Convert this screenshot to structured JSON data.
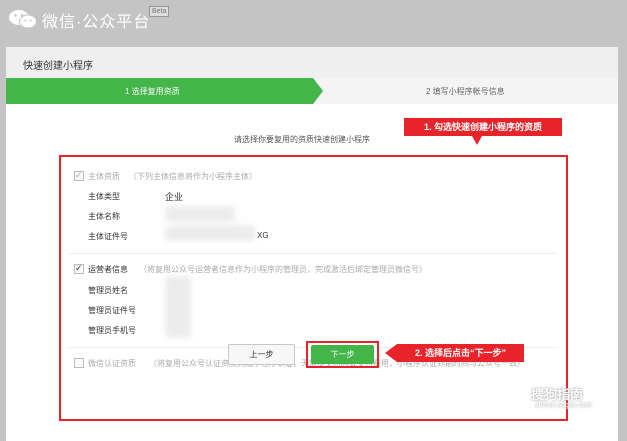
{
  "header": {
    "brand": "微信·公众平台",
    "beta": "Beta"
  },
  "modal": {
    "title": "快速创建小程序",
    "steps": [
      {
        "label": "1 选择复用资质",
        "active": true
      },
      {
        "label": "2 填写小程序帐号信息",
        "active": false
      }
    ],
    "prompt": "请选择你要复用的资质快速创建小程序",
    "sections": {
      "entity": {
        "checked": true,
        "title": "主体资质",
        "hint": "（下列主体信息将作为小程序主体）",
        "rows": [
          {
            "label": "主体类型",
            "value": "企业"
          },
          {
            "label": "主体名称",
            "value": ""
          },
          {
            "label": "主体证件号",
            "value": "XG"
          }
        ]
      },
      "operator": {
        "checked": true,
        "title": "运营者信息",
        "hint": "（将复用公众号运营者信息作为小程序的管理员，完成激活后绑定管理员微信号）",
        "rows": [
          {
            "label": "管理员姓名",
            "value": ""
          },
          {
            "label": "管理员证件号",
            "value": ""
          },
          {
            "label": "管理员手机号",
            "value": ""
          }
        ]
      },
      "certification": {
        "checked": false,
        "title": "微信认证资质",
        "hint": "（将复用公众号认证资质完成小程序认证，无需提交材料或支付费用，小程序认证到期时间与公众号一致）"
      }
    },
    "buttons": {
      "prev": "上一步",
      "next": "下一步"
    }
  },
  "annotations": {
    "callout1": "1. 勾选快速创建小程序的资质",
    "callout2": "2. 选择后点击“下一步”"
  },
  "watermark": {
    "logo": "搜狗指南",
    "url": "zhinan.sogou.com"
  },
  "colors": {
    "accent_green": "#44b549",
    "annotation_red": "#e8242a",
    "overlay_grey": "#c4c4c4"
  }
}
